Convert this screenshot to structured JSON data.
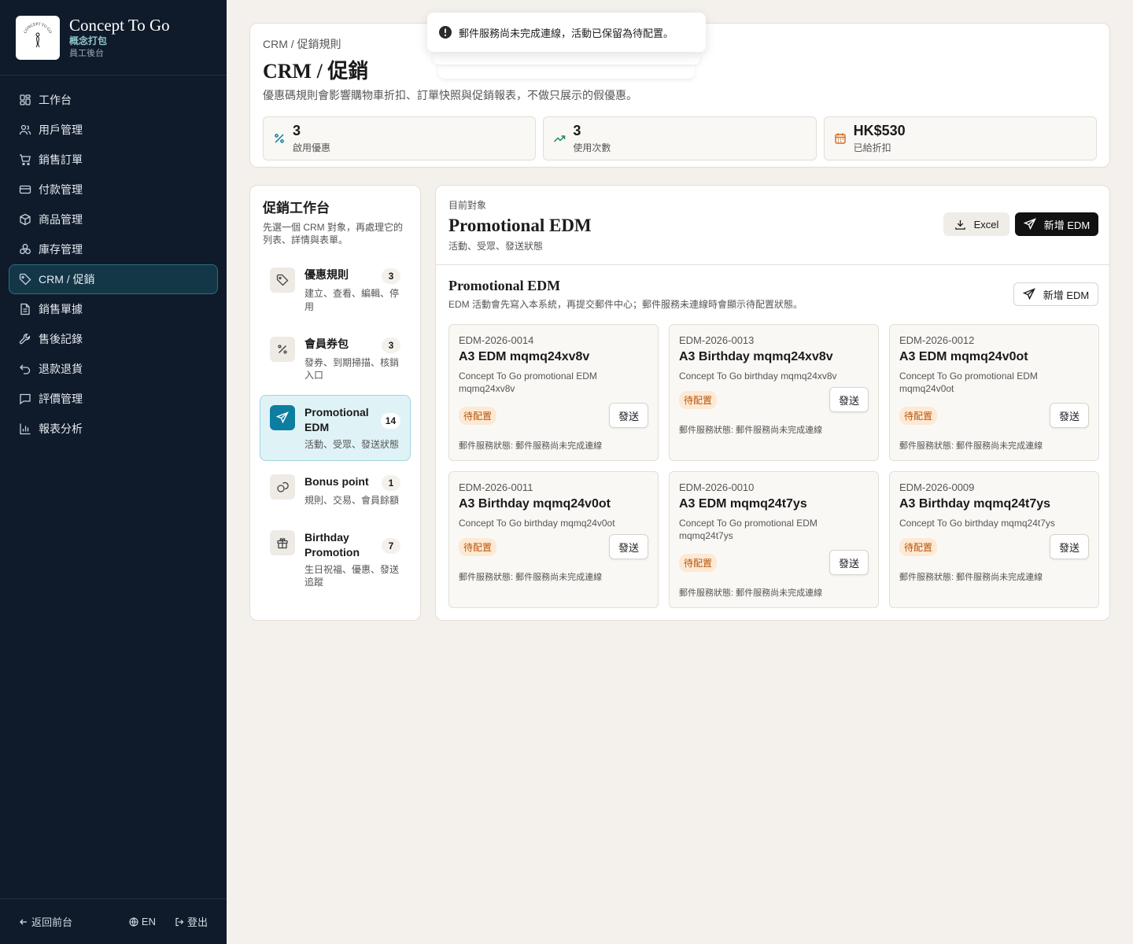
{
  "brand": {
    "name": "Concept To Go",
    "cn": "概念打包",
    "sub": "員工後台",
    "logo_text": "CONCEPT TO GO"
  },
  "nav": [
    {
      "label": "工作台",
      "icon": "dashboard-icon"
    },
    {
      "label": "用戶管理",
      "icon": "users-icon"
    },
    {
      "label": "銷售訂單",
      "icon": "cart-icon"
    },
    {
      "label": "付款管理",
      "icon": "credit-card-icon"
    },
    {
      "label": "商品管理",
      "icon": "box-icon"
    },
    {
      "label": "庫存管理",
      "icon": "boxes-icon"
    },
    {
      "label": "CRM / 促銷",
      "icon": "tag-icon",
      "active": true
    },
    {
      "label": "銷售單據",
      "icon": "document-icon"
    },
    {
      "label": "售後記錄",
      "icon": "wrench-icon"
    },
    {
      "label": "退款退貨",
      "icon": "undo-icon"
    },
    {
      "label": "評價管理",
      "icon": "message-icon"
    },
    {
      "label": "報表分析",
      "icon": "bar-chart-icon"
    }
  ],
  "footer": {
    "back": "返回前台",
    "lang": "EN",
    "logout": "登出"
  },
  "toast": {
    "message": "郵件服務尚未完成連線，活動已保留為待配置。"
  },
  "header": {
    "breadcrumb": "CRM / 促銷規則",
    "title": "CRM / 促銷",
    "desc": "優惠碼規則會影響購物車折扣、訂單快照與促銷報表，不做只展示的假優惠。"
  },
  "stats": [
    {
      "value": "3",
      "label": "啟用優惠",
      "icon": "percent-icon",
      "color": "#0e7ea0"
    },
    {
      "value": "3",
      "label": "使用次數",
      "icon": "trending-up-icon",
      "color": "#1a8a5a"
    },
    {
      "value": "HK$530",
      "label": "已給折扣",
      "icon": "calendar-icon",
      "color": "#d2691e"
    }
  ],
  "workbench": {
    "title": "促銷工作台",
    "desc": "先選一個 CRM 對象，再處理它的列表、詳情與表單。",
    "items": [
      {
        "name": "優惠規則",
        "count": "3",
        "sub": "建立、查看、編輯、停用",
        "icon": "tag-icon"
      },
      {
        "name": "會員券包",
        "count": "3",
        "sub": "發券、到期掃描、核銷入口",
        "icon": "percent-icon"
      },
      {
        "name": "Promotional EDM",
        "count": "14",
        "sub": "活動、受眾、發送狀態",
        "icon": "send-icon",
        "active": true
      },
      {
        "name": "Bonus point",
        "count": "1",
        "sub": "規則、交易、會員餘額",
        "icon": "coins-icon"
      },
      {
        "name": "Birthday Promotion",
        "count": "7",
        "sub": "生日祝福、優惠、發送追蹤",
        "icon": "gift-icon"
      }
    ]
  },
  "target": {
    "kicker": "目前對象",
    "title": "Promotional EDM",
    "sub": "活動、受眾、發送狀態",
    "excel_label": "Excel",
    "new_label": "新增 EDM"
  },
  "section": {
    "title": "Promotional EDM",
    "desc": "EDM 活動會先寫入本系統，再提交郵件中心；郵件服務未連線時會顯示待配置狀態。",
    "new_label": "新增 EDM"
  },
  "edms": [
    {
      "id": "EDM-2026-0014",
      "title": "A3 EDM mqmq24xv8v",
      "desc": "Concept To Go promotional EDM mqmq24xv8v",
      "badge": "待配置",
      "send": "發送",
      "status": "郵件服務狀態: 郵件服務尚未完成連線"
    },
    {
      "id": "EDM-2026-0013",
      "title": "A3 Birthday mqmq24xv8v",
      "desc": "Concept To Go birthday mqmq24xv8v",
      "badge": "待配置",
      "send": "發送",
      "status": "郵件服務狀態: 郵件服務尚未完成連線"
    },
    {
      "id": "EDM-2026-0012",
      "title": "A3 EDM mqmq24v0ot",
      "desc": "Concept To Go promotional EDM mqmq24v0ot",
      "badge": "待配置",
      "send": "發送",
      "status": "郵件服務狀態: 郵件服務尚未完成連線"
    },
    {
      "id": "EDM-2026-0011",
      "title": "A3 Birthday mqmq24v0ot",
      "desc": "Concept To Go birthday mqmq24v0ot",
      "badge": "待配置",
      "send": "發送",
      "status": "郵件服務狀態: 郵件服務尚未完成連線"
    },
    {
      "id": "EDM-2026-0010",
      "title": "A3 EDM mqmq24t7ys",
      "desc": "Concept To Go promotional EDM mqmq24t7ys",
      "badge": "待配置",
      "send": "發送",
      "status": "郵件服務狀態: 郵件服務尚未完成連線"
    },
    {
      "id": "EDM-2026-0009",
      "title": "A3 Birthday mqmq24t7ys",
      "desc": "Concept To Go birthday mqmq24t7ys",
      "badge": "待配置",
      "send": "發送",
      "status": "郵件服務狀態: 郵件服務尚未完成連線"
    }
  ]
}
